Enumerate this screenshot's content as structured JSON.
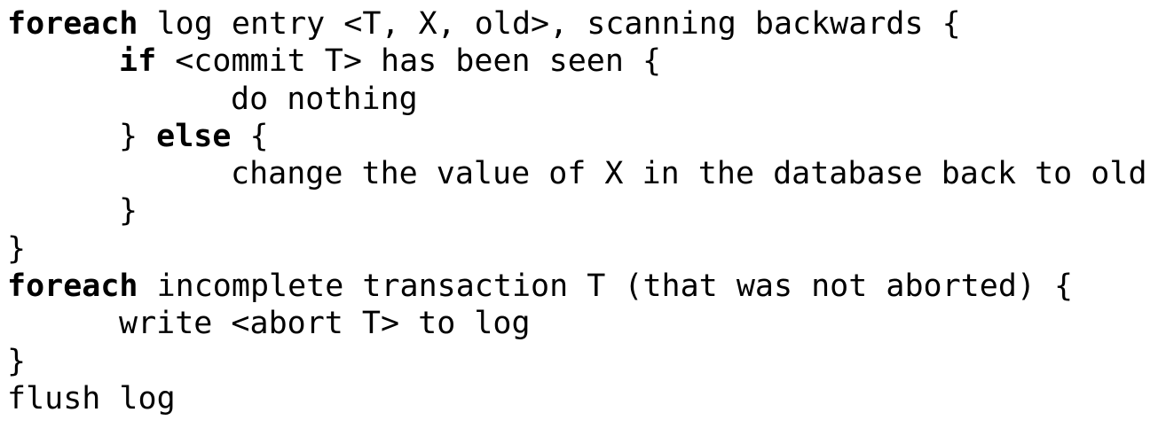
{
  "code": {
    "line1": {
      "keyword": "foreach",
      "text": " log entry <T, X, old>, scanning backwards {"
    },
    "line2": {
      "keyword": "if",
      "text": " <commit T> has been seen {"
    },
    "line3": {
      "text": "do nothing"
    },
    "line4": {
      "open": "} ",
      "keyword": "else",
      "text": " {"
    },
    "line5": {
      "text": "change the value of X in the database back to old"
    },
    "line6": {
      "text": "}"
    },
    "line7": {
      "text": "}"
    },
    "line8": {
      "keyword": "foreach",
      "text": " incomplete transaction T (that was not aborted) {"
    },
    "line9": {
      "text": "write <abort T> to log"
    },
    "line10": {
      "text": "}"
    },
    "line11": {
      "text": "flush log"
    }
  }
}
